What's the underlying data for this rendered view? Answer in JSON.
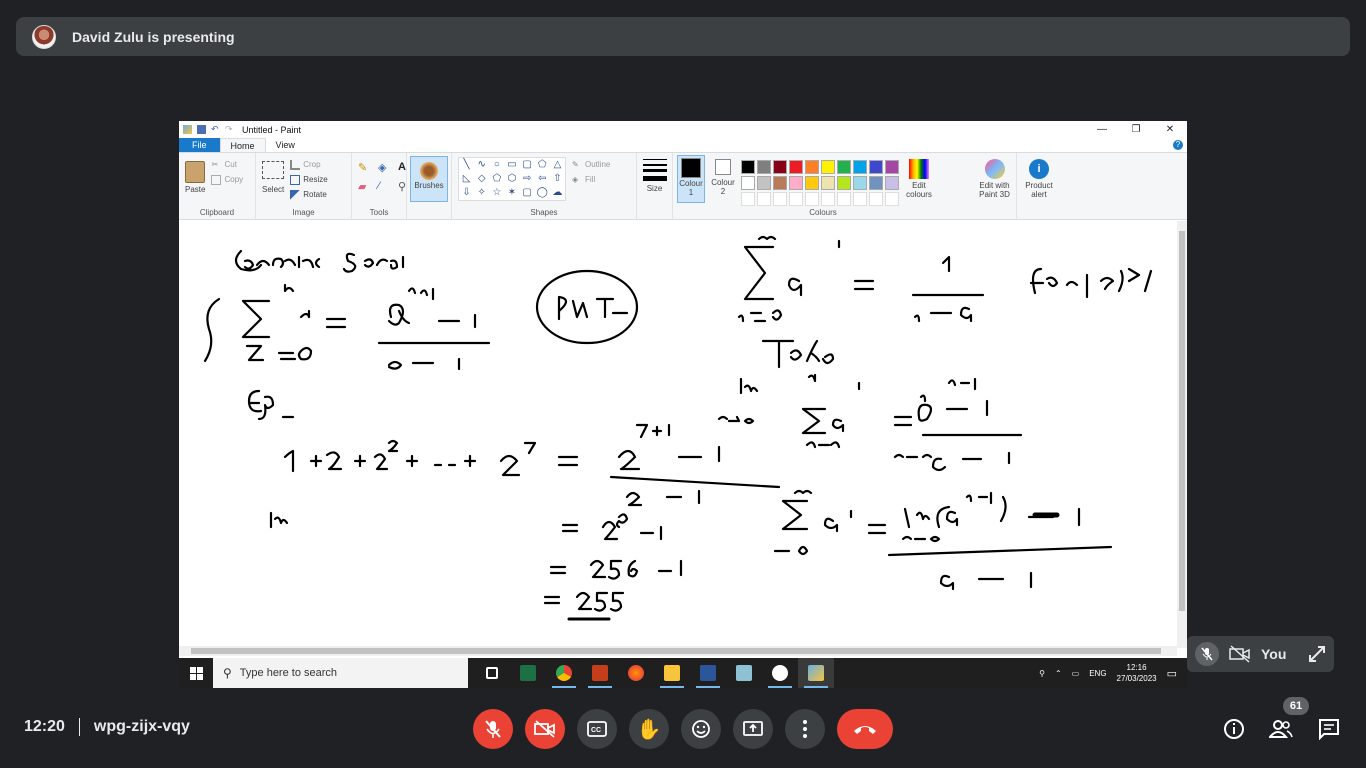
{
  "presenter": {
    "banner": "David Zulu is presenting"
  },
  "paint": {
    "title": "Untitled - Paint",
    "tabs": [
      "File",
      "Home",
      "View"
    ],
    "clipboard": {
      "paste": "Paste",
      "cut": "Cut",
      "copy": "Copy",
      "label": "Clipboard"
    },
    "image": {
      "select": "Select",
      "crop": "Crop",
      "resize": "Resize",
      "rotate": "Rotate",
      "label": "Image"
    },
    "tools": {
      "label": "Tools",
      "brushes": "Brushes"
    },
    "shapes": {
      "outline": "Outline",
      "fill": "Fill",
      "label": "Shapes"
    },
    "size": "Size",
    "colour1": "Colour 1",
    "colour2": "Colour 2",
    "colours_label": "Colours",
    "edit_colours": "Edit colours",
    "edit_paint3d": "Edit with Paint 3D",
    "product_alert": "Product alert",
    "palette": [
      "#000000",
      "#7f7f7f",
      "#880015",
      "#ed1c24",
      "#ff7f27",
      "#fff200",
      "#22b14c",
      "#00a2e8",
      "#3f48cc",
      "#a349a4",
      "#ffffff",
      "#c3c3c3",
      "#b97a57",
      "#ffaec9",
      "#ffc90e",
      "#efe4b0",
      "#b5e61d",
      "#99d9ea",
      "#7092be",
      "#c8bfe7"
    ]
  },
  "taskbar": {
    "search_placeholder": "Type here to search",
    "lang": "ENG",
    "time": "12:16",
    "date": "27/03/2023"
  },
  "meeting": {
    "time": "12:20",
    "code": "wpg-zijx-vqy",
    "self_label": "You",
    "participants": "61"
  }
}
